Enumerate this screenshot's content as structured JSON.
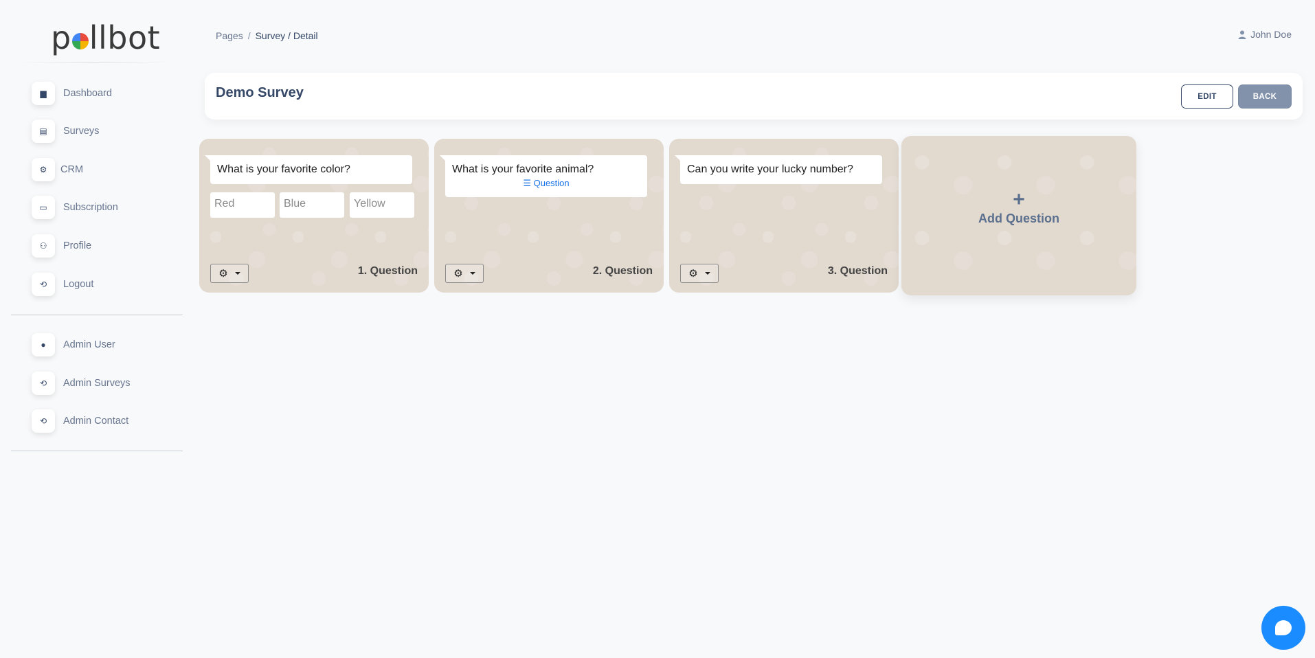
{
  "logo": {
    "pre": "p",
    "post": "llbot"
  },
  "sidebar": {
    "items": [
      {
        "label": "Dashboard",
        "icon": "shop-icon",
        "glyph": "▆"
      },
      {
        "label": "Surveys",
        "icon": "document-icon",
        "glyph": "▤"
      },
      {
        "label": "CRM",
        "icon": "settings-icon",
        "glyph": "⚙"
      },
      {
        "label": "Subscription",
        "icon": "credit-card-icon",
        "glyph": "▭"
      },
      {
        "label": "Profile",
        "icon": "user-settings-icon",
        "glyph": "⚇"
      },
      {
        "label": "Logout",
        "icon": "logout-icon",
        "glyph": "⟲"
      }
    ],
    "admin_items": [
      {
        "label": "Admin User",
        "icon": "user-icon",
        "glyph": "●"
      },
      {
        "label": "Admin Surveys",
        "icon": "logout-icon",
        "glyph": "⟲"
      },
      {
        "label": "Admin Contact",
        "icon": "logout-icon",
        "glyph": "⟲"
      }
    ]
  },
  "breadcrumb": {
    "root": "Pages",
    "separator": "/",
    "current": "Survey / Detail"
  },
  "user": {
    "name": "John Doe"
  },
  "header": {
    "title": "Demo Survey",
    "edit_label": "EDIT",
    "back_label": "BACK"
  },
  "questions": [
    {
      "text": "What is your favorite color?",
      "options": [
        "Red",
        "Blue",
        "Yellow"
      ],
      "number_label": "1. Question"
    },
    {
      "text": "What is your favorite animal?",
      "sub_label": "Question",
      "number_label": "2. Question"
    },
    {
      "text": "Can you write your lucky number?",
      "number_label": "3. Question"
    }
  ],
  "add_card": {
    "plus": "+",
    "label": "Add Question"
  },
  "colors": {
    "accent": "#344767",
    "chat": "#1a8cff",
    "card_bg": "#e2d9cf",
    "back_button": "#8392ab"
  }
}
